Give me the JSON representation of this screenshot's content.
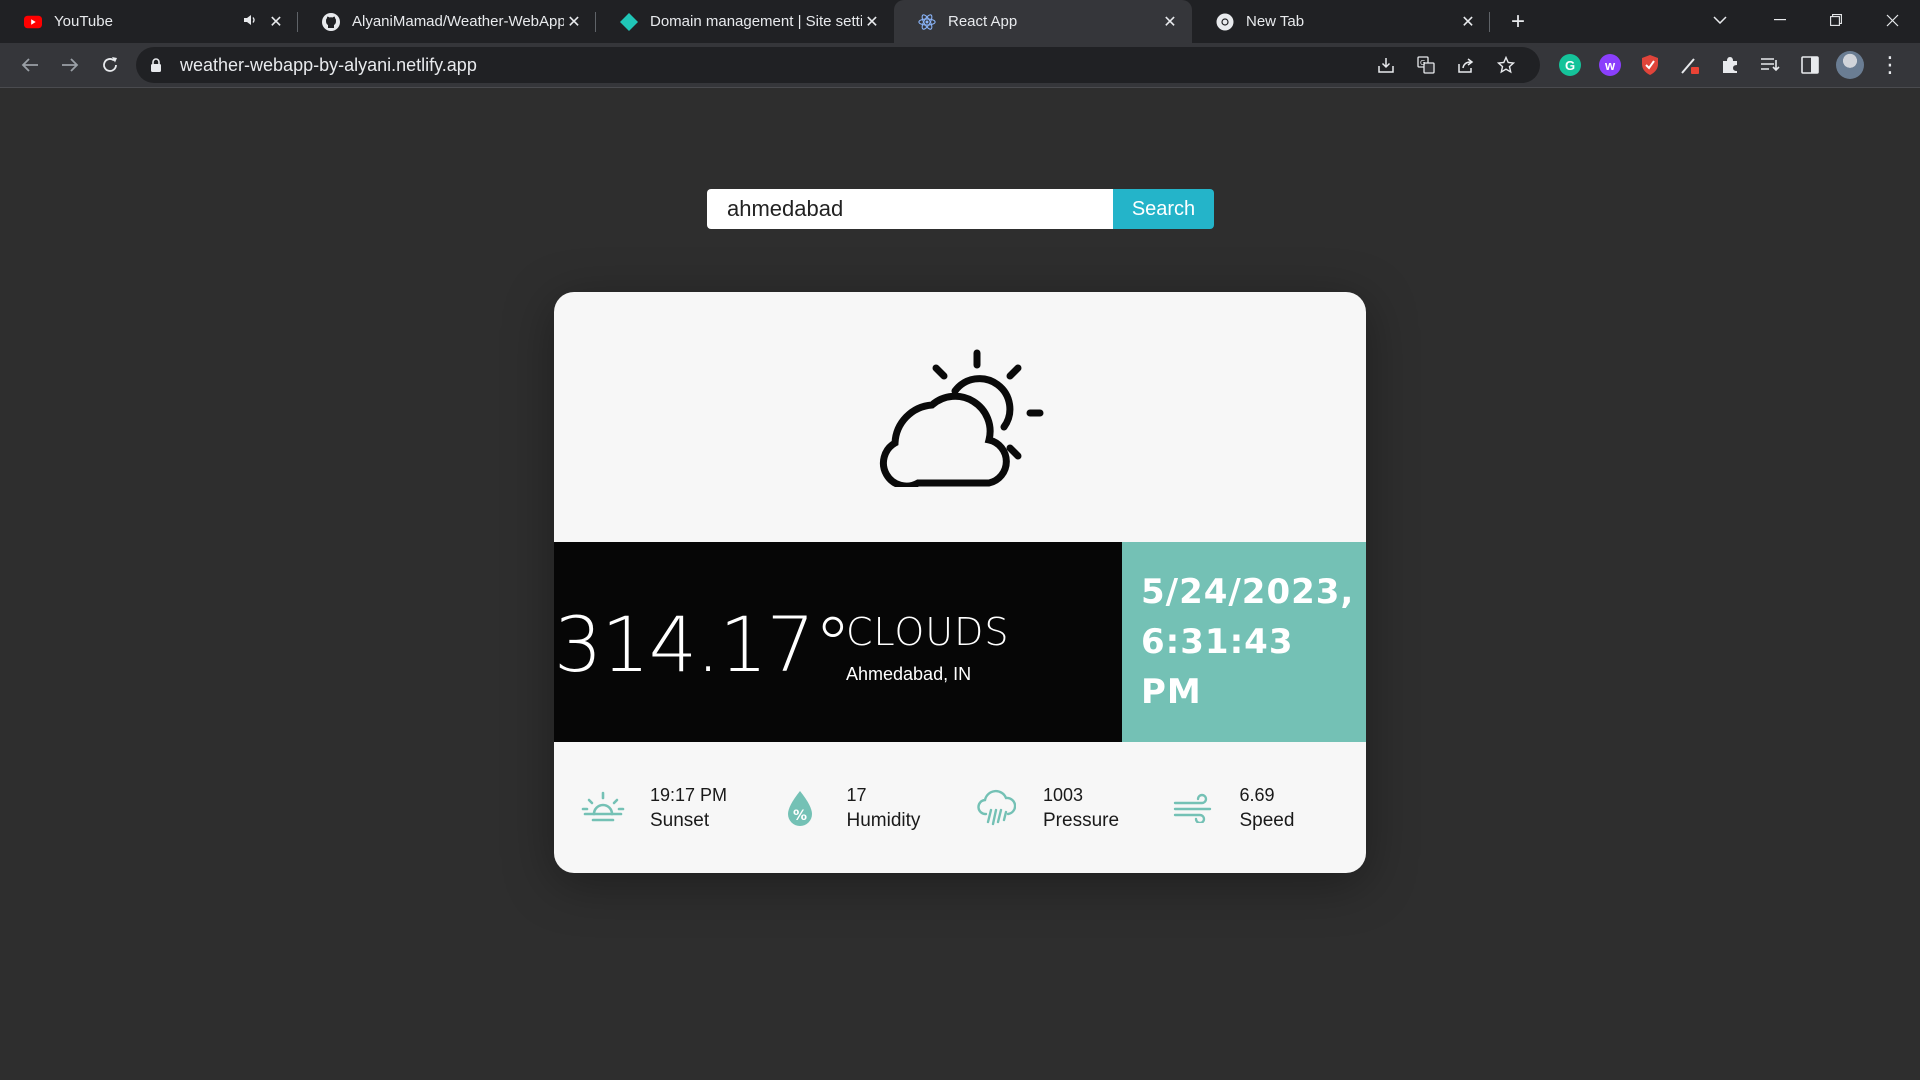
{
  "browser": {
    "tabs": [
      {
        "title": "YouTube",
        "favicon": "youtube-icon",
        "audio": true
      },
      {
        "title": "AlyaniMamad/Weather-WebApp",
        "favicon": "github-icon"
      },
      {
        "title": "Domain management | Site settin",
        "favicon": "netlify-icon"
      },
      {
        "title": "React App",
        "favicon": "react-icon",
        "active": true
      },
      {
        "title": "New Tab",
        "favicon": "chrome-icon"
      }
    ],
    "url": "weather-webapp-by-alyani.netlify.app"
  },
  "search": {
    "value": "ahmedabad",
    "button_label": "Search"
  },
  "weather": {
    "icon": "partly-cloudy-icon",
    "temperature": "314.17°",
    "condition": "CLOUDS",
    "location": "Ahmedabad, IN",
    "date": "5/24/2023,",
    "time": "6:31:43 PM"
  },
  "stats": [
    {
      "icon": "sunset-icon",
      "value": "19:17 PM",
      "label": "Sunset"
    },
    {
      "icon": "humidity-icon",
      "value": "17",
      "label": "Humidity"
    },
    {
      "icon": "pressure-icon",
      "value": "1003",
      "label": "Pressure"
    },
    {
      "icon": "wind-icon",
      "value": "6.69",
      "label": "Speed"
    }
  ],
  "colors": {
    "page_bg": "#2e2e2e",
    "search_button": "#24b4c9",
    "date_panel": "#74c1b5",
    "temp_panel": "#060606",
    "stat_icon": "#74c1b5"
  }
}
